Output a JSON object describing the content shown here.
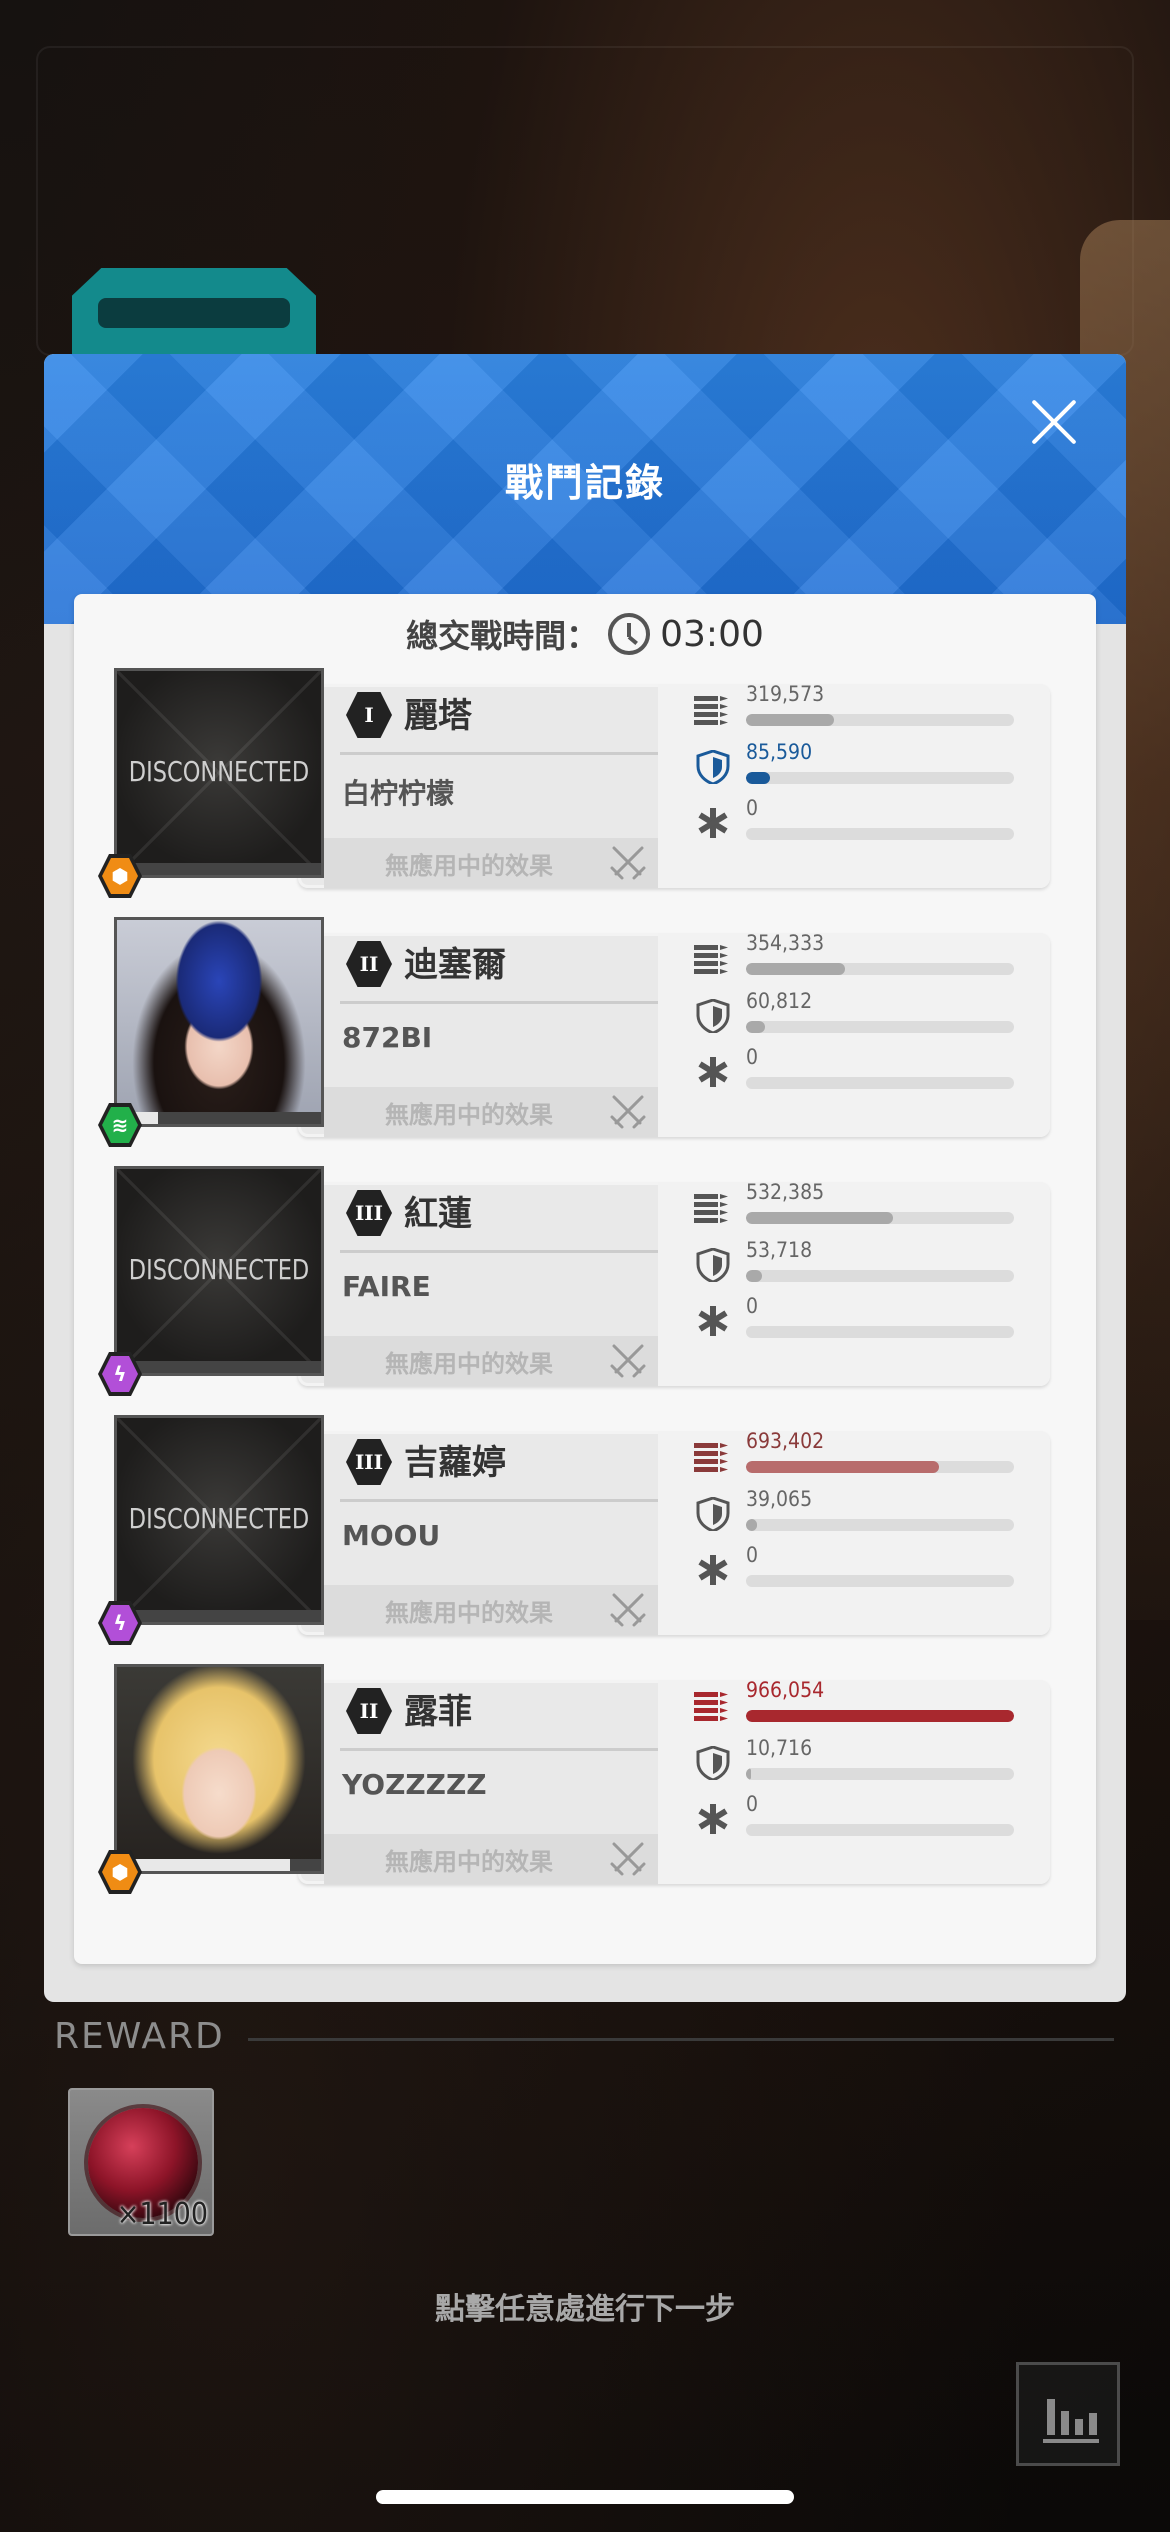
{
  "modal": {
    "title": "戰鬥記錄",
    "close_icon": "close-icon"
  },
  "summary": {
    "total_time_label": "總交戰時間：",
    "total_time": "03:00",
    "clock_icon": "clock-icon"
  },
  "effect_text": "無應用中的效果",
  "disconnected_text": "DISCONNECTED",
  "players": [
    {
      "rank": "I",
      "character": "麗塔",
      "player": "白柠柠檬",
      "element": "hexagon-burst-icon",
      "element_color": "#f08c14",
      "disconnected": true,
      "hp_fraction": 0.0,
      "stats": [
        {
          "icon": "attack-icon",
          "value": "319,573",
          "fraction": 0.33,
          "color": "#a9a9a9",
          "text_color": "#666666"
        },
        {
          "icon": "shield-icon",
          "value": "85,590",
          "fraction": 0.09,
          "color": "#1a5a9a",
          "text_color": "#1a5a9a"
        },
        {
          "icon": "heal-icon",
          "value": "0",
          "fraction": 0.0,
          "color": "#a9a9a9",
          "text_color": "#666666"
        }
      ]
    },
    {
      "rank": "II",
      "character": "迪塞爾",
      "player": "872BI",
      "element": "wind-icon",
      "element_color": "#22b04a",
      "disconnected": false,
      "hp_fraction": 0.2,
      "stats": [
        {
          "icon": "attack-icon",
          "value": "354,333",
          "fraction": 0.37,
          "color": "#a9a9a9",
          "text_color": "#666666"
        },
        {
          "icon": "shield-icon",
          "value": "60,812",
          "fraction": 0.07,
          "color": "#a9a9a9",
          "text_color": "#666666"
        },
        {
          "icon": "heal-icon",
          "value": "0",
          "fraction": 0.0,
          "color": "#a9a9a9",
          "text_color": "#666666"
        }
      ]
    },
    {
      "rank": "III",
      "character": "紅蓮",
      "player": "FAIRE",
      "element": "lightning-icon",
      "element_color": "#b24fd8",
      "disconnected": true,
      "hp_fraction": 0.0,
      "stats": [
        {
          "icon": "attack-icon",
          "value": "532,385",
          "fraction": 0.55,
          "color": "#a9a9a9",
          "text_color": "#666666"
        },
        {
          "icon": "shield-icon",
          "value": "53,718",
          "fraction": 0.06,
          "color": "#a9a9a9",
          "text_color": "#666666"
        },
        {
          "icon": "heal-icon",
          "value": "0",
          "fraction": 0.0,
          "color": "#a9a9a9",
          "text_color": "#666666"
        }
      ]
    },
    {
      "rank": "III",
      "character": "吉蘿婷",
      "player": "MOOU",
      "element": "lightning-icon",
      "element_color": "#b24fd8",
      "disconnected": true,
      "hp_fraction": 0.0,
      "stats": [
        {
          "icon": "attack-icon",
          "value": "693,402",
          "fraction": 0.72,
          "color": "#b86c6c",
          "text_color": "#8a3a3a"
        },
        {
          "icon": "shield-icon",
          "value": "39,065",
          "fraction": 0.04,
          "color": "#a9a9a9",
          "text_color": "#666666"
        },
        {
          "icon": "heal-icon",
          "value": "0",
          "fraction": 0.0,
          "color": "#a9a9a9",
          "text_color": "#666666"
        }
      ]
    },
    {
      "rank": "II",
      "character": "露菲",
      "player": "YOZZZZZ",
      "element": "hexagon-burst-icon",
      "element_color": "#f08c14",
      "disconnected": false,
      "hp_fraction": 0.85,
      "stats": [
        {
          "icon": "attack-icon",
          "value": "966,054",
          "fraction": 1.0,
          "color": "#a8282e",
          "text_color": "#a8282e"
        },
        {
          "icon": "shield-icon",
          "value": "10,716",
          "fraction": 0.01,
          "color": "#a9a9a9",
          "text_color": "#666666"
        },
        {
          "icon": "heal-icon",
          "value": "0",
          "fraction": 0.0,
          "color": "#a9a9a9",
          "text_color": "#666666"
        }
      ]
    }
  ],
  "reward": {
    "label": "REWARD",
    "item_icon": "red-core-orb-icon",
    "item_count": "×1100"
  },
  "continue_hint": "點擊任意處進行下一步",
  "stats_button_icon": "bar-chart-icon"
}
